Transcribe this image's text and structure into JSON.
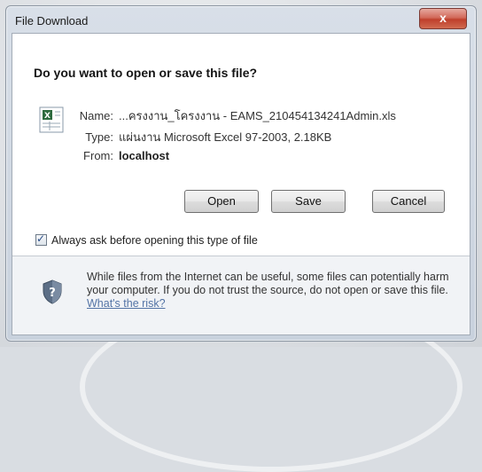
{
  "window": {
    "title": "File Download",
    "close_label": "x"
  },
  "dialog": {
    "question": "Do you want to open or save this file?",
    "icon": "excel-file-icon",
    "name_label": "Name:",
    "name_value": "...ครงงาน_โครงงาน - EAMS_210454134241Admin.xls",
    "type_label": "Type:",
    "type_value": "แผ่นงาน Microsoft Excel 97-2003, 2.18KB",
    "from_label": "From:",
    "from_value": "localhost"
  },
  "buttons": {
    "open": "Open",
    "save": "Save",
    "cancel": "Cancel"
  },
  "checkbox": {
    "label": "Always ask before opening this type of file",
    "checked": true
  },
  "warning": {
    "icon": "shield-question-icon",
    "text": "While files from the Internet can be useful, some files can potentially harm your computer. If you do not trust the source, do not open or save this file.",
    "link": "What's the risk?"
  },
  "colors": {
    "link": "#5474a6",
    "close_button": "#c94a38",
    "shield": "#5c6e86"
  }
}
